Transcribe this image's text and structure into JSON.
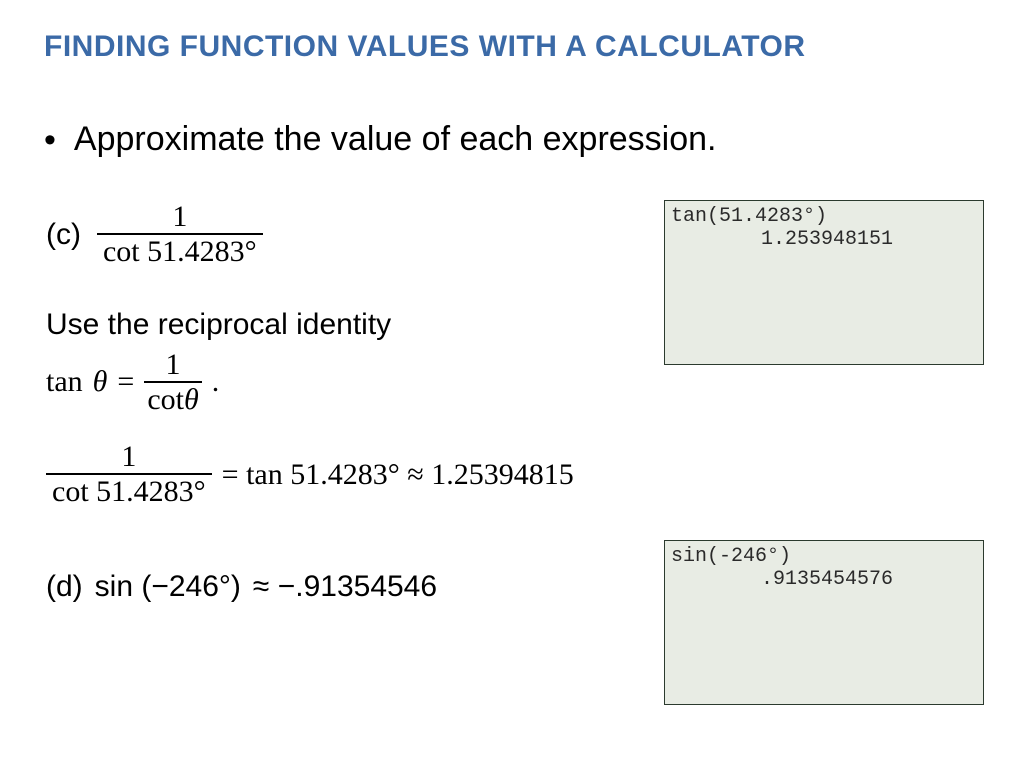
{
  "title": "FINDING FUNCTION VALUES WITH A CALCULATOR",
  "bullet": "Approximate the value of each expression.",
  "partC": {
    "label": "(c)",
    "num": "1",
    "den": "cot 51.4283°"
  },
  "recipLabel": "Use the reciprocal identity",
  "identity": {
    "lhs": "tan",
    "theta": "θ",
    "eq": "=",
    "num": "1",
    "den_fn": "cot",
    "period": "."
  },
  "equation": {
    "num": "1",
    "den": "cot 51.4283°",
    "mid": "= tan 51.4283° ≈ 1.25394815"
  },
  "partD": {
    "label": "(d)",
    "expr": "sin (−246°)",
    "approx": "≈ −.91354546"
  },
  "calc1": {
    "in": "tan(51.4283°)",
    "out": "1.253948151"
  },
  "calc2": {
    "in": "sin(-246°)",
    "out": ".9135454576"
  }
}
